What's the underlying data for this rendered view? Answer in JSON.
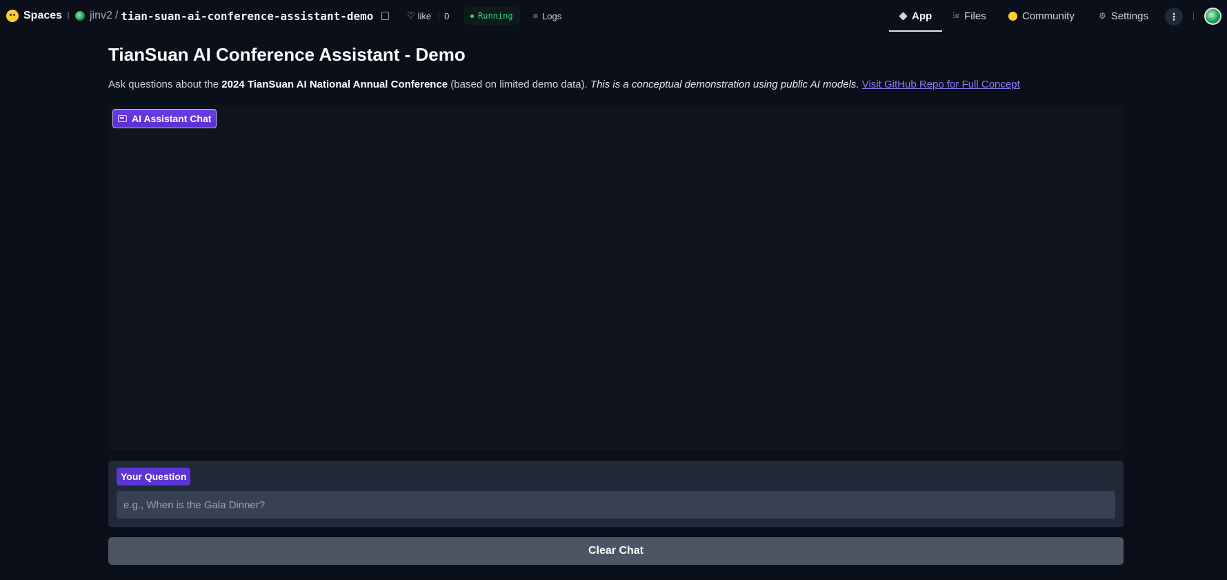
{
  "topbar": {
    "brand_label": "Spaces",
    "repo_owner": "jinv2",
    "repo_sep": "/",
    "repo_name": "tian-suan-ai-conference-assistant-demo",
    "like_label": "like",
    "like_count": "0",
    "status_label": "Running",
    "logs_label": "Logs",
    "nav": {
      "app": "App",
      "files": "Files",
      "community": "Community",
      "settings": "Settings"
    },
    "more_icon": "⋮"
  },
  "main": {
    "title": "TianSuan AI Conference Assistant - Demo",
    "intro_prefix": "Ask questions about the ",
    "intro_bold": "2024 TianSuan AI National Annual Conference",
    "intro_middle": " (based on limited demo data). ",
    "intro_italic": "This is a conceptual demonstration using public AI models.",
    "intro_space": " ",
    "intro_link": "Visit GitHub Repo for Full Concept"
  },
  "chat": {
    "label": "AI Assistant Chat"
  },
  "question": {
    "label": "Your Question",
    "placeholder": "e.g., When is the Gala Dinner?",
    "value": ""
  },
  "actions": {
    "clear_label": "Clear Chat"
  },
  "colors": {
    "background": "#0b0f19",
    "accent": "#5b35d5",
    "running": "#34d399",
    "link": "#8b7cf6"
  }
}
